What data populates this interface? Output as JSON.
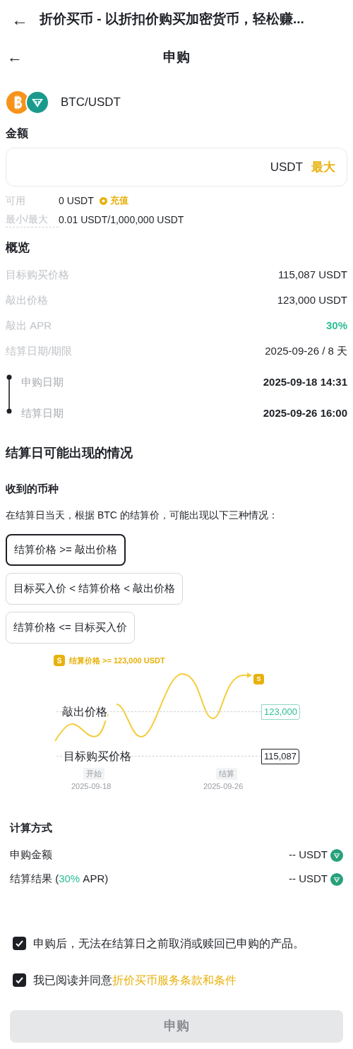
{
  "top_bar": {
    "back": "←",
    "title": "折价买币 - 以折扣价购买加密货币，轻松赚..."
  },
  "header": {
    "back": "←",
    "title": "申购"
  },
  "pair": {
    "name": "BTC/USDT"
  },
  "amount": {
    "label": "金额",
    "unit": "USDT",
    "max": "最大"
  },
  "available": {
    "label": "可用",
    "value": "0 USDT",
    "deposit": "充值"
  },
  "limits": {
    "label": "最小/最大",
    "value": "0.01 USDT/1,000,000 USDT"
  },
  "overview": {
    "title": "概览",
    "rows": [
      {
        "label": "目标购买价格",
        "value": "115,087 USDT",
        "kind": "plain"
      },
      {
        "label": "敲出价格",
        "value": "123,000 USDT",
        "kind": "plain"
      },
      {
        "label": "敲出 APR",
        "value": "30%",
        "kind": "highlight"
      },
      {
        "label": "结算日期/期限",
        "value": "2025-09-26 / 8 天",
        "kind": "plain"
      }
    ],
    "timeline": [
      {
        "label": "申购日期",
        "value": "2025-09-18 14:31"
      },
      {
        "label": "结算日期",
        "value": "2025-09-26 16:00"
      }
    ]
  },
  "scenarios": {
    "title": "结算日可能出现的情况",
    "subtitle": "收到的币种",
    "description": "在结算日当天，根据 BTC 的结算价，可能出现以下三种情况：",
    "options": [
      {
        "label": "结算价格 >= 敲出价格",
        "selected": true
      },
      {
        "label": "目标买入价 < 结算价格 < 敲出价格",
        "selected": false
      },
      {
        "label": "结算价格 <= 目标买入价",
        "selected": false
      }
    ],
    "illustration": {
      "badge": "S",
      "legend": "结算价格 >= 123,000 USDT",
      "end_badge": "S",
      "upper_label": "敲出价格",
      "upper_value": "123,000",
      "lower_label": "目标购买价格",
      "lower_value": "115,087",
      "start_label": "开始",
      "start_date": "2025-09-18",
      "end_label": "结算",
      "end_date": "2025-09-26"
    }
  },
  "calculation": {
    "title": "计算方式",
    "rows": [
      {
        "label": "申购金额",
        "value": "-- USDT"
      },
      {
        "label": "结算结果 (**30%** APR)",
        "value": "-- USDT"
      }
    ]
  },
  "agreements": [
    {
      "text": "申购后，无法在结算日之前取消或赎回已申购的产品。",
      "checked": true
    },
    {
      "text": "我已阅读并同意",
      "link": "折价买币服务条款和条件",
      "checked": true
    }
  ],
  "submit": {
    "label": "申购",
    "disabled": true
  }
}
